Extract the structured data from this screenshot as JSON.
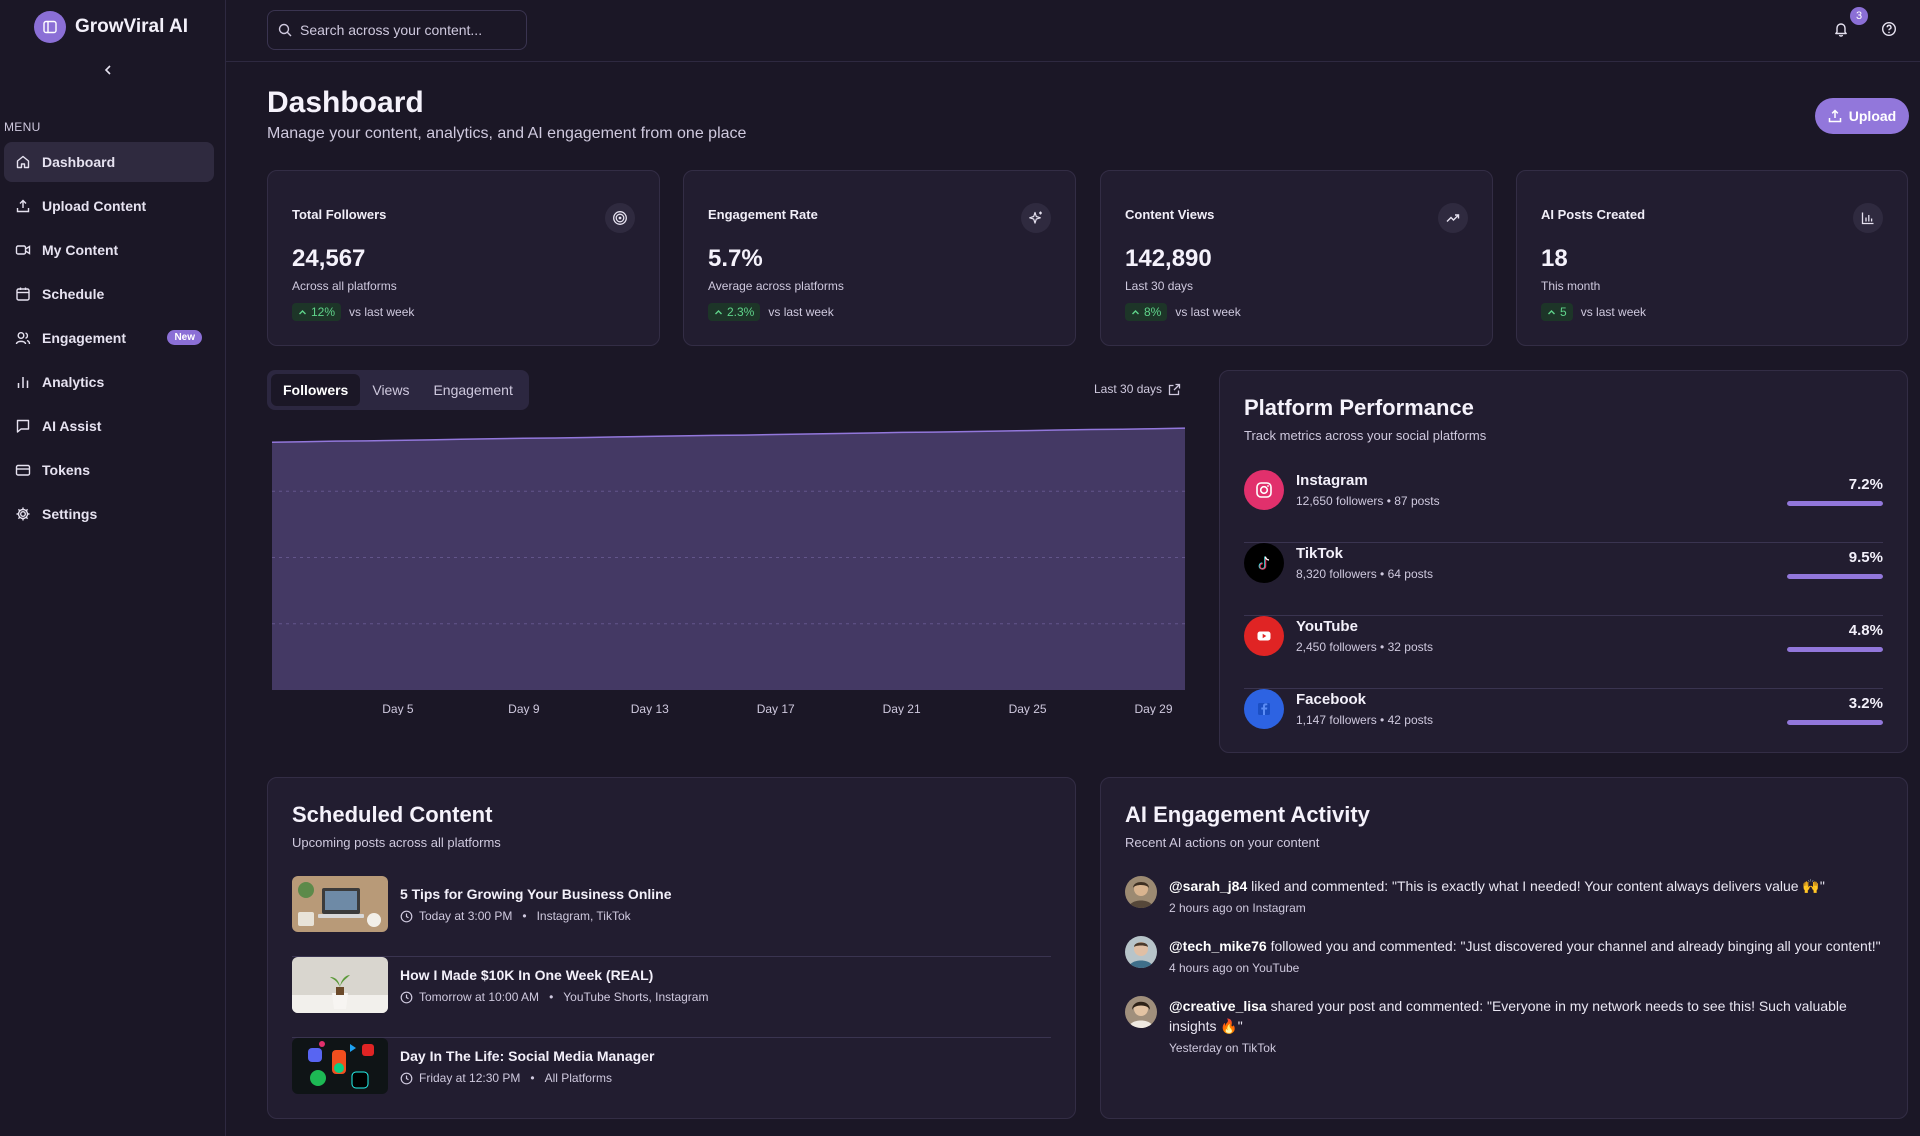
{
  "app": {
    "name": "GrowViral AI"
  },
  "sidebar": {
    "menu_label": "MENU",
    "items": [
      {
        "label": "Dashboard",
        "icon": "home-icon",
        "active": true
      },
      {
        "label": "Upload Content",
        "icon": "upload-icon"
      },
      {
        "label": "My Content",
        "icon": "video-icon"
      },
      {
        "label": "Schedule",
        "icon": "calendar-icon"
      },
      {
        "label": "Engagement",
        "icon": "users-icon",
        "badge": "New"
      },
      {
        "label": "Analytics",
        "icon": "bar-chart-icon"
      },
      {
        "label": "AI Assist",
        "icon": "message-icon"
      },
      {
        "label": "Tokens",
        "icon": "card-icon"
      },
      {
        "label": "Settings",
        "icon": "gear-icon"
      }
    ]
  },
  "topbar": {
    "search_placeholder": "Search across your content...",
    "notification_count": "3"
  },
  "header": {
    "title": "Dashboard",
    "subtitle": "Manage your content, analytics, and AI engagement from one place",
    "upload_label": "Upload"
  },
  "stats": [
    {
      "title": "Total Followers",
      "value": "24,567",
      "sub": "Across all platforms",
      "trend": "12%",
      "trend_label": "vs last week",
      "icon": "target-icon"
    },
    {
      "title": "Engagement Rate",
      "value": "5.7%",
      "sub": "Average across platforms",
      "trend": "2.3%",
      "trend_label": "vs last week",
      "icon": "sparkle-icon"
    },
    {
      "title": "Content Views",
      "value": "142,890",
      "sub": "Last 30 days",
      "trend": "8%",
      "trend_label": "vs last week",
      "icon": "trending-up-icon"
    },
    {
      "title": "AI Posts Created",
      "value": "18",
      "sub": "This month",
      "trend": "5",
      "trend_label": "vs last week",
      "icon": "bar-chart-icon"
    }
  ],
  "chart": {
    "tabs": [
      "Followers",
      "Views",
      "Engagement"
    ],
    "active_tab": "Followers",
    "range_label": "Last 30 days"
  },
  "chart_data": {
    "type": "area",
    "x": [
      "Day 1",
      "Day 2",
      "Day 3",
      "Day 4",
      "Day 5",
      "Day 6",
      "Day 7",
      "Day 8",
      "Day 9",
      "Day 10",
      "Day 11",
      "Day 12",
      "Day 13",
      "Day 14",
      "Day 15",
      "Day 16",
      "Day 17",
      "Day 18",
      "Day 19",
      "Day 20",
      "Day 21",
      "Day 22",
      "Day 23",
      "Day 24",
      "Day 25",
      "Day 26",
      "Day 27",
      "Day 28",
      "Day 29",
      "Day 30"
    ],
    "tick_labels": [
      "Day 5",
      "Day 9",
      "Day 13",
      "Day 17",
      "Day 21",
      "Day 25",
      "Day 29"
    ],
    "series": [
      {
        "values": [
          93.5,
          93.7,
          93.9,
          94.0,
          94.2,
          94.4,
          94.6,
          94.8,
          95.0,
          95.1,
          95.3,
          95.5,
          95.7,
          95.9,
          96.1,
          96.2,
          96.4,
          96.6,
          96.8,
          97.0,
          97.2,
          97.3,
          97.5,
          97.7,
          97.9,
          98.1,
          98.3,
          98.4,
          98.6,
          98.8
        ]
      }
    ],
    "ylim": [
      0,
      100
    ],
    "grid": true,
    "color": "#9277db"
  },
  "platforms": {
    "title": "Platform Performance",
    "subtitle": "Track metrics across your social platforms",
    "items": [
      {
        "name": "Instagram",
        "meta": "12,650 followers • 87 posts",
        "rate": "7.2%",
        "fill": 1.0,
        "color": "#e1306c",
        "icon": "instagram-icon"
      },
      {
        "name": "TikTok",
        "meta": "8,320 followers • 64 posts",
        "rate": "9.5%",
        "fill": 1.0,
        "color": "#000000",
        "icon": "tiktok-icon"
      },
      {
        "name": "YouTube",
        "meta": "2,450 followers • 32 posts",
        "rate": "4.8%",
        "fill": 1.0,
        "color": "#e02424",
        "icon": "youtube-icon"
      },
      {
        "name": "Facebook",
        "meta": "1,147 followers • 42 posts",
        "rate": "3.2%",
        "fill": 1.0,
        "color": "#2d63e2",
        "icon": "facebook-icon"
      }
    ]
  },
  "scheduled": {
    "title": "Scheduled Content",
    "subtitle": "Upcoming posts across all platforms",
    "items": [
      {
        "title": "5 Tips for Growing Your Business Online",
        "time": "Today at 3:00 PM",
        "platforms": "Instagram, TikTok"
      },
      {
        "title": "How I Made $10K In One Week (REAL)",
        "time": "Tomorrow at 10:00 AM",
        "platforms": "YouTube Shorts, Instagram"
      },
      {
        "title": "Day In The Life: Social Media Manager",
        "time": "Friday at 12:30 PM",
        "platforms": "All Platforms"
      }
    ]
  },
  "activity": {
    "title": "AI Engagement Activity",
    "subtitle": "Recent AI actions on your content",
    "items": [
      {
        "user": "@sarah_j84",
        "text": " liked and commented: \"This is exactly what I needed! Your content always delivers value 🙌\"",
        "time": "2 hours ago on Instagram"
      },
      {
        "user": "@tech_mike76",
        "text": " followed you and commented: \"Just discovered your channel and already binging all your content!\"",
        "time": "4 hours ago on YouTube"
      },
      {
        "user": "@creative_lisa",
        "text": " shared your post and commented: \"Everyone in my network needs to see this! Such valuable insights 🔥\"",
        "time": "Yesterday on TikTok"
      }
    ]
  }
}
